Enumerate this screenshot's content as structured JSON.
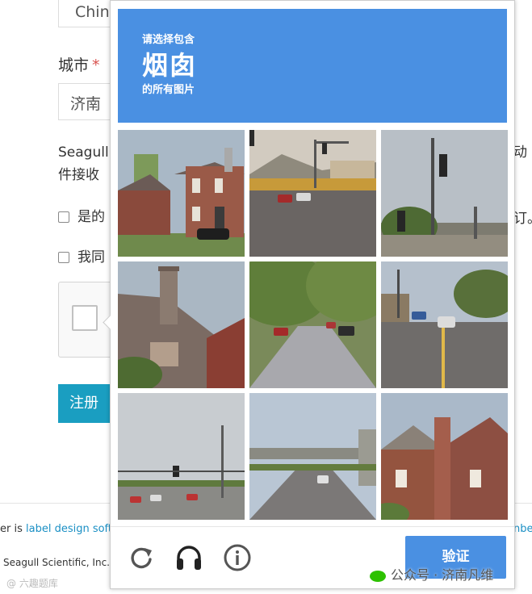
{
  "form": {
    "country_value": "China",
    "city_label": "城市",
    "required_mark": "*",
    "city_value": "济南",
    "notice_left_l1": "Seagull",
    "notice_left_l2": "件接收",
    "notice_right_l1": "动",
    "consent_left": "是的",
    "consent_right": "订。",
    "agree_left": "我同",
    "register_button": "注册"
  },
  "footer": {
    "left_prefix": "er is ",
    "left_link": "label design softw",
    "right_link": "nbe",
    "copyright": "Seagull Scientific, Inc.",
    "watermark_bottom": "@ 六趣题库"
  },
  "captcha": {
    "instruction_prefix": "请选择包含",
    "target_object": "烟囱",
    "instruction_suffix": "的所有图片",
    "verify_button": "验证",
    "accent_color": "#4a90e2",
    "icons": [
      "reload-icon",
      "audio-icon",
      "info-icon"
    ],
    "tiles": [
      {
        "row": 1,
        "col": 1,
        "scene": "brick house with chimney"
      },
      {
        "row": 1,
        "col": 2,
        "scene": "intersection with traffic lights"
      },
      {
        "row": 1,
        "col": 3,
        "scene": "traffic light on pole"
      },
      {
        "row": 2,
        "col": 1,
        "scene": "roof with chimney"
      },
      {
        "row": 2,
        "col": 2,
        "scene": "tree-lined street with cars"
      },
      {
        "row": 2,
        "col": 3,
        "scene": "street with cars"
      },
      {
        "row": 3,
        "col": 1,
        "scene": "highway with traffic light"
      },
      {
        "row": 3,
        "col": 2,
        "scene": "road under overpass"
      },
      {
        "row": 3,
        "col": 3,
        "scene": "brick house with chimney"
      }
    ]
  },
  "watermark": {
    "text": "公众号 · 济南凡维"
  }
}
